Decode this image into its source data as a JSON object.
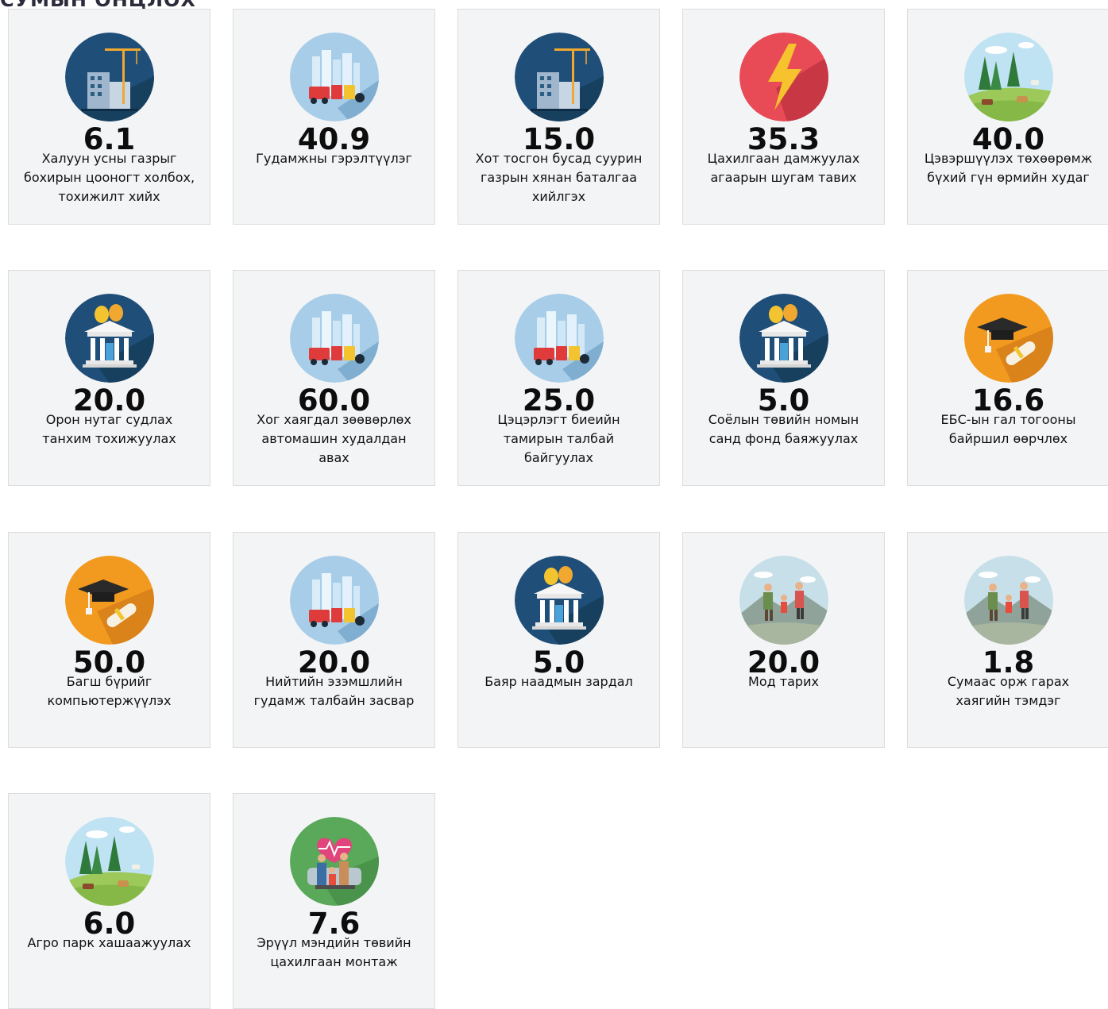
{
  "heading": "СУМЫН ОНЦЛОХ",
  "colors": {
    "card_bg": "#f3f4f6",
    "card_border": "#dcdcdc"
  },
  "cards": [
    {
      "value": "6.1",
      "label": "Халуун усны газрыг\nбохирын цооногт холбох,\nтохижилт хийх",
      "icon": "construction-icon"
    },
    {
      "value": "40.9",
      "label": "Гудамжны гэрэлтүүлэг",
      "icon": "city-waste-icon"
    },
    {
      "value": "15.0",
      "label": "Хот тосгон бусад суурин\nгазрын хянан баталгаа\nхийлгэх",
      "icon": "construction-icon"
    },
    {
      "value": "35.3",
      "label": "Цахилгаан дамжуулах\nагаарын шугам тавих",
      "icon": "lightning-icon"
    },
    {
      "value": "40.0",
      "label": "Цэвэршүүлэх төхөөрөмж\nбүхий гүн өрмийн худаг",
      "icon": "pasture-icon"
    },
    {
      "value": "20.0",
      "label": "Орон нутаг судлах\nтанхим тохижуулах",
      "icon": "theatre-icon"
    },
    {
      "value": "60.0",
      "label": "Хог хаягдал зөөвөрлөх\nавтомашин худалдан\nавах",
      "icon": "city-waste-icon"
    },
    {
      "value": "25.0",
      "label": "Цэцэрлэгт биеийн\nтамирын талбай\nбайгуулах",
      "icon": "city-waste-icon"
    },
    {
      "value": "5.0",
      "label": "Соёлын төвийн номын\nсанд фонд баяжуулах",
      "icon": "theatre-icon"
    },
    {
      "value": "16.6",
      "label": "ЕБС-ын гал тогооны\nбайршил өөрчлөх",
      "icon": "graduation-icon"
    },
    {
      "value": "50.0",
      "label": "Багш бүрийг\nкомпьютержүүлэх",
      "icon": "graduation-icon"
    },
    {
      "value": "20.0",
      "label": "Нийтийн эзэмшлийн\nгудамж талбайн засвар",
      "icon": "city-waste-icon"
    },
    {
      "value": "5.0",
      "label": "Баяр наадмын зардал",
      "icon": "theatre-icon"
    },
    {
      "value": "20.0",
      "label": "Мод тарих",
      "icon": "hikers-icon"
    },
    {
      "value": "1.8",
      "label": "Сумаас орж гарах\nхаягийн тэмдэг",
      "icon": "hikers-icon"
    },
    {
      "value": "6.0",
      "label": "Агро парк хашаажуулах",
      "icon": "pasture-icon"
    },
    {
      "value": "7.6",
      "label": "Эрүүл мэндийн төвийн\nцахилгаан монтаж",
      "icon": "family-health-icon"
    }
  ]
}
